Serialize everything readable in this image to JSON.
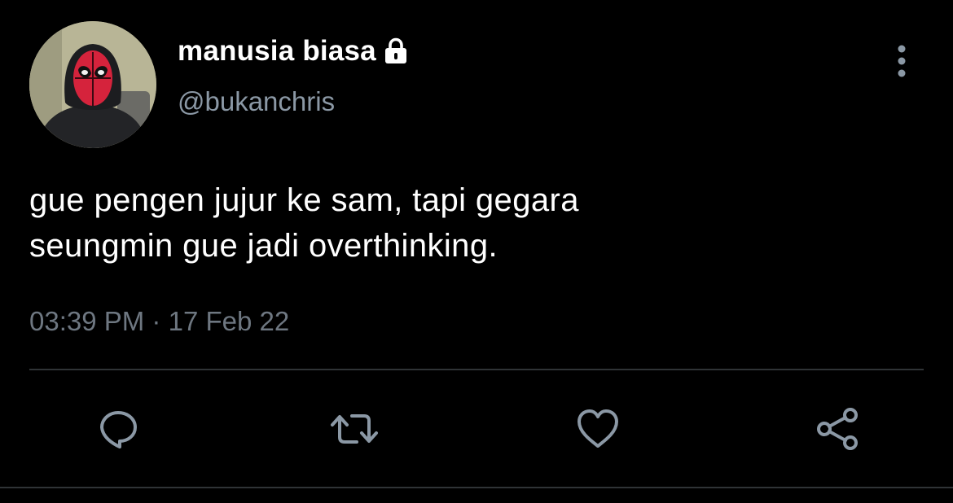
{
  "tweet": {
    "display_name": "manusia biasa",
    "handle": "@bukanchris",
    "text": "gue pengen jujur ke sam, tapi gegara\nseungmin gue jadi overthinking.",
    "time": "03:39 PM",
    "separator": "·",
    "date": "17 Feb 22",
    "protected_icon": "lock-icon",
    "more_icon": "more-vertical-icon"
  },
  "actions": [
    {
      "name": "reply",
      "icon": "reply-icon"
    },
    {
      "name": "retweet",
      "icon": "retweet-icon"
    },
    {
      "name": "like",
      "icon": "heart-icon"
    },
    {
      "name": "share",
      "icon": "share-icon"
    }
  ],
  "colors": {
    "background": "#000000",
    "text_primary": "#ffffff",
    "text_secondary": "#8b98a5",
    "meta_text": "#6e7781",
    "divider": "#2f3336",
    "icon": "#8b98a5"
  }
}
